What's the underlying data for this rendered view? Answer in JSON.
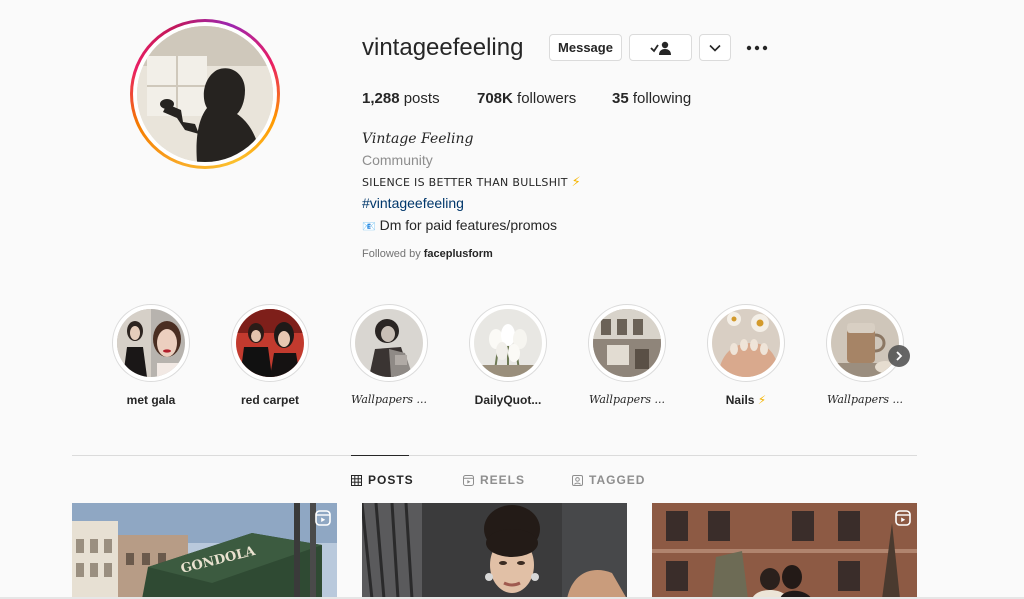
{
  "profile": {
    "username": "vintageefeeling",
    "buttons": {
      "message": "Message"
    },
    "stats": {
      "posts_count": "1,288",
      "posts_label": "posts",
      "followers_count": "708K",
      "followers_label": "followers",
      "following_count": "35",
      "following_label": "following"
    },
    "bio": {
      "name": "Vintage Feeling",
      "category": "Community",
      "line1": "SILENCE IS BETTER THAN BULLSHIT",
      "line1_emoji": "⚡",
      "hashtag": "#vintageefeeling",
      "dm_emoji": "📧",
      "dm_text": "Dm for paid features/promos"
    },
    "followed_by": {
      "prefix": "Followed by",
      "user": "faceplusform"
    }
  },
  "highlights": [
    {
      "label": "met gala",
      "icon": "highlight-met-gala"
    },
    {
      "label": "red carpet",
      "icon": "highlight-red-carpet"
    },
    {
      "label": "Wallpapers ...",
      "icon": "highlight-wallpapers"
    },
    {
      "label": "DailyQuot...",
      "icon": "highlight-daily-quotes"
    },
    {
      "label": "Wallpapers ...",
      "icon": "highlight-wallpapers"
    },
    {
      "label": "Nails",
      "label_emoji": "⚡",
      "icon": "highlight-nails"
    },
    {
      "label": "Wallpapers ...",
      "icon": "highlight-wallpapers"
    }
  ],
  "tabs": [
    {
      "label": "POSTS",
      "icon": "grid-icon",
      "active": true
    },
    {
      "label": "REELS",
      "icon": "reels-icon",
      "active": false
    },
    {
      "label": "TAGGED",
      "icon": "tagged-icon",
      "active": false
    }
  ],
  "posts": [
    {
      "caption_sign": "GONDOLA",
      "type": "reel"
    },
    {
      "type": "reel"
    },
    {
      "type": "reel"
    }
  ],
  "colors": {
    "accent_link": "#00376b",
    "text": "#262626",
    "muted": "#8e8e8e",
    "border": "#dbdbdb"
  }
}
